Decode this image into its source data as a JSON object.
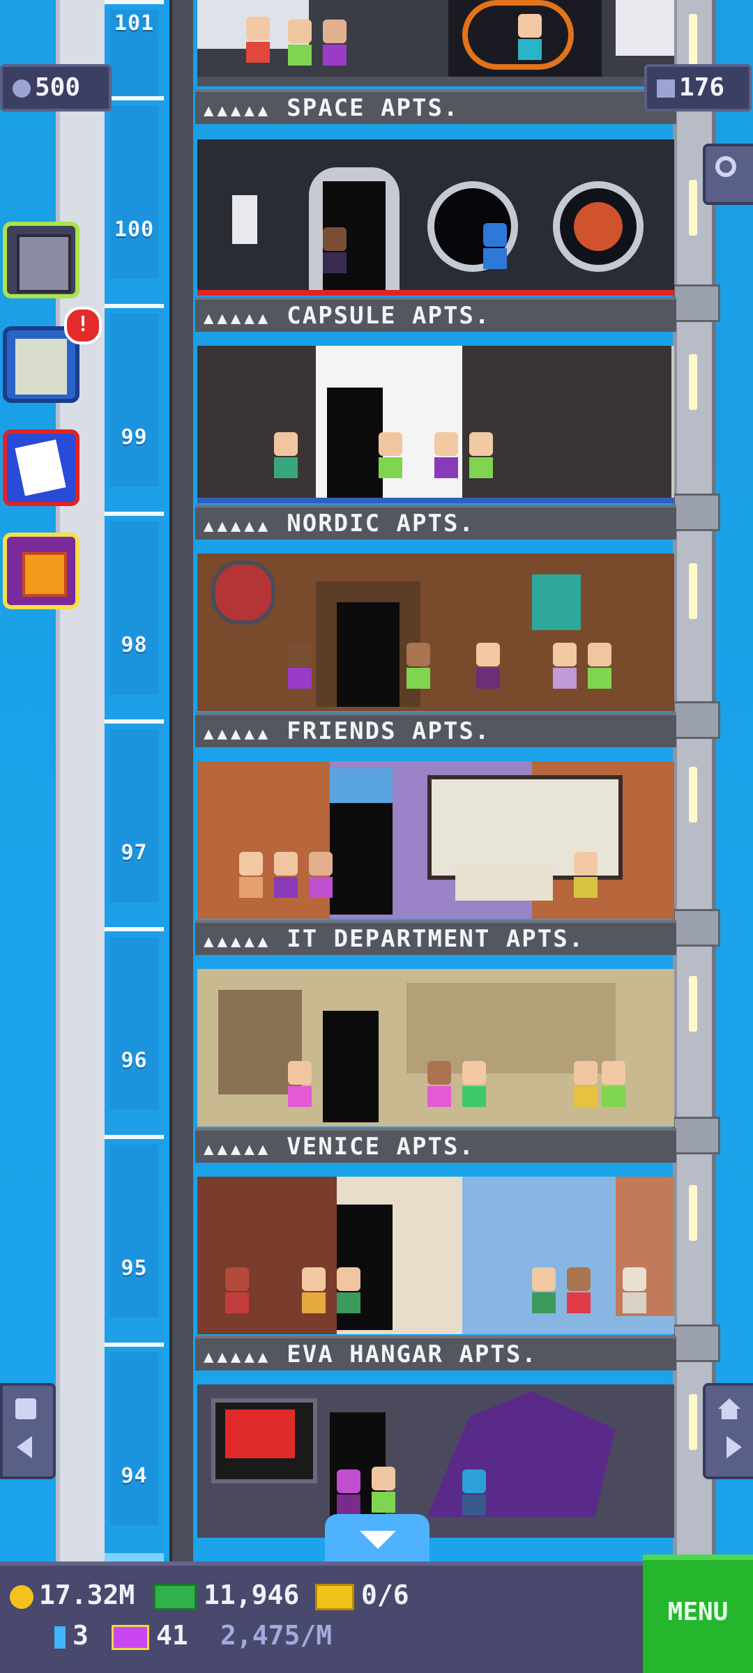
{
  "top_badges": {
    "population": "500",
    "floors": "176"
  },
  "partial_top_floor_number": "101",
  "floors": [
    {
      "name": "SPACE APTS.",
      "number": "100"
    },
    {
      "name": "CAPSULE APTS.",
      "number": "99"
    },
    {
      "name": "NORDIC APTS.",
      "number": "98"
    },
    {
      "name": "FRIENDS APTS.",
      "number": "97"
    },
    {
      "name": "IT DEPARTMENT APTS.",
      "number": "96"
    },
    {
      "name": "VENICE APTS.",
      "number": "95"
    },
    {
      "name": "EVA HANGAR APTS.",
      "number": "94"
    }
  ],
  "label_dots": "▲▲▲▲▲",
  "side_buttons": [
    {
      "icon": "building-icon"
    },
    {
      "icon": "checklist-icon",
      "alert": "!"
    },
    {
      "icon": "calendar-icon"
    },
    {
      "icon": "gift-icon"
    }
  ],
  "currency": {
    "coins": "17.32M",
    "bux": "11,946",
    "tickets": "0/6",
    "gems": "3",
    "vip": "41",
    "rate": "2,475/M"
  },
  "menu_label": "MENU",
  "colors": {
    "sky": "#1aa0e8",
    "menu": "#25b62e",
    "bar": "#48496d"
  }
}
